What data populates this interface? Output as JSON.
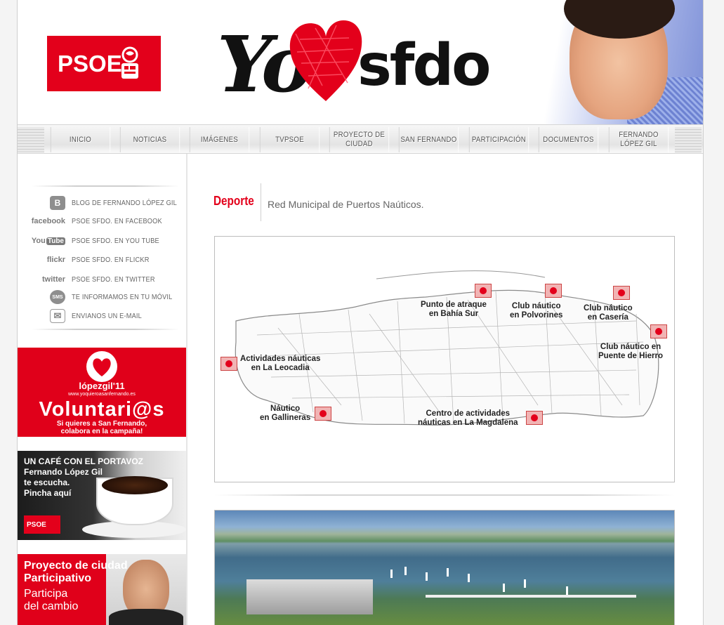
{
  "header": {
    "party_logo_text": "PSOE",
    "slogan_yo": "Yo",
    "slogan_sfdo": "sfdo"
  },
  "nav": {
    "items": [
      "INICIO",
      "NOTICIAS",
      "IMÁGENES",
      "TVPSOE",
      "PROYECTO DE CIUDAD",
      "SAN FERNANDO",
      "PARTICIPACIÓN",
      "DOCUMENTOS",
      "FERNANDO LÓPEZ GIL"
    ]
  },
  "sidebar": {
    "links": [
      {
        "icon": "blog-icon",
        "icon_text": "B",
        "label": "BLOG DE FERNANDO LÓPEZ GIL"
      },
      {
        "icon": "facebook-icon",
        "icon_text": "facebook",
        "label": "PSOE SFDO. EN FACEBOOK"
      },
      {
        "icon": "youtube-icon",
        "icon_text": "You",
        "icon_text2": "Tube",
        "label": "PSOE SFDO. EN YOU TUBE"
      },
      {
        "icon": "flickr-icon",
        "icon_text": "flickr",
        "label": "PSOE SFDO. EN FLICKR"
      },
      {
        "icon": "twitter-icon",
        "icon_text": "twitter",
        "label": "PSOE SFDO. EN TWITTER"
      },
      {
        "icon": "sms-icon",
        "icon_text": "SMS",
        "label": "TE INFORMAMOS EN TU MÓVIL"
      },
      {
        "icon": "email-icon",
        "icon_text": "✉",
        "label": "ENVIANOS UN E-MAIL"
      }
    ],
    "banner_volunteers": {
      "brand": "lópezgil'11",
      "url": "www.yoquieroasanfernando.es",
      "headline": "Voluntari@s",
      "tagline1": "Si quieres a San Fernando,",
      "tagline2": "colabora en la campaña!"
    },
    "banner_cafe": {
      "line1": "UN CAFÉ CON EL PORTAVOZ",
      "line2": "Fernando López Gil",
      "line3": "te escucha.",
      "line4": "Pincha aquí",
      "logo": "PSOE"
    },
    "banner_proyecto": {
      "line1": "Proyecto de ciudad",
      "line2": "Participativo",
      "line3": "Participa",
      "line4": "del cambio"
    }
  },
  "content": {
    "section_title": "Deporte",
    "section_subtitle": "Red Municipal de Puertos Naúticos.",
    "map_labels": [
      {
        "line1": "Punto de atraque",
        "line2": "en Bahía Sur"
      },
      {
        "line1": "Club náutico",
        "line2": "en Polvorines"
      },
      {
        "line1": "Club náutico",
        "line2": "en Casería"
      },
      {
        "line1": "Club náutico en",
        "line2": "Puente de Hierro"
      },
      {
        "line1": "Actividades náuticas",
        "line2": "en La Leocadia"
      },
      {
        "line1": "Náutico",
        "line2": "en Gallineras"
      },
      {
        "line1": "Centro de actividades",
        "line2": "náuticas en La Magdalena"
      }
    ]
  },
  "colors": {
    "brand_red": "#e3001b",
    "nav_text": "#555555",
    "sidebar_text": "#666666"
  }
}
